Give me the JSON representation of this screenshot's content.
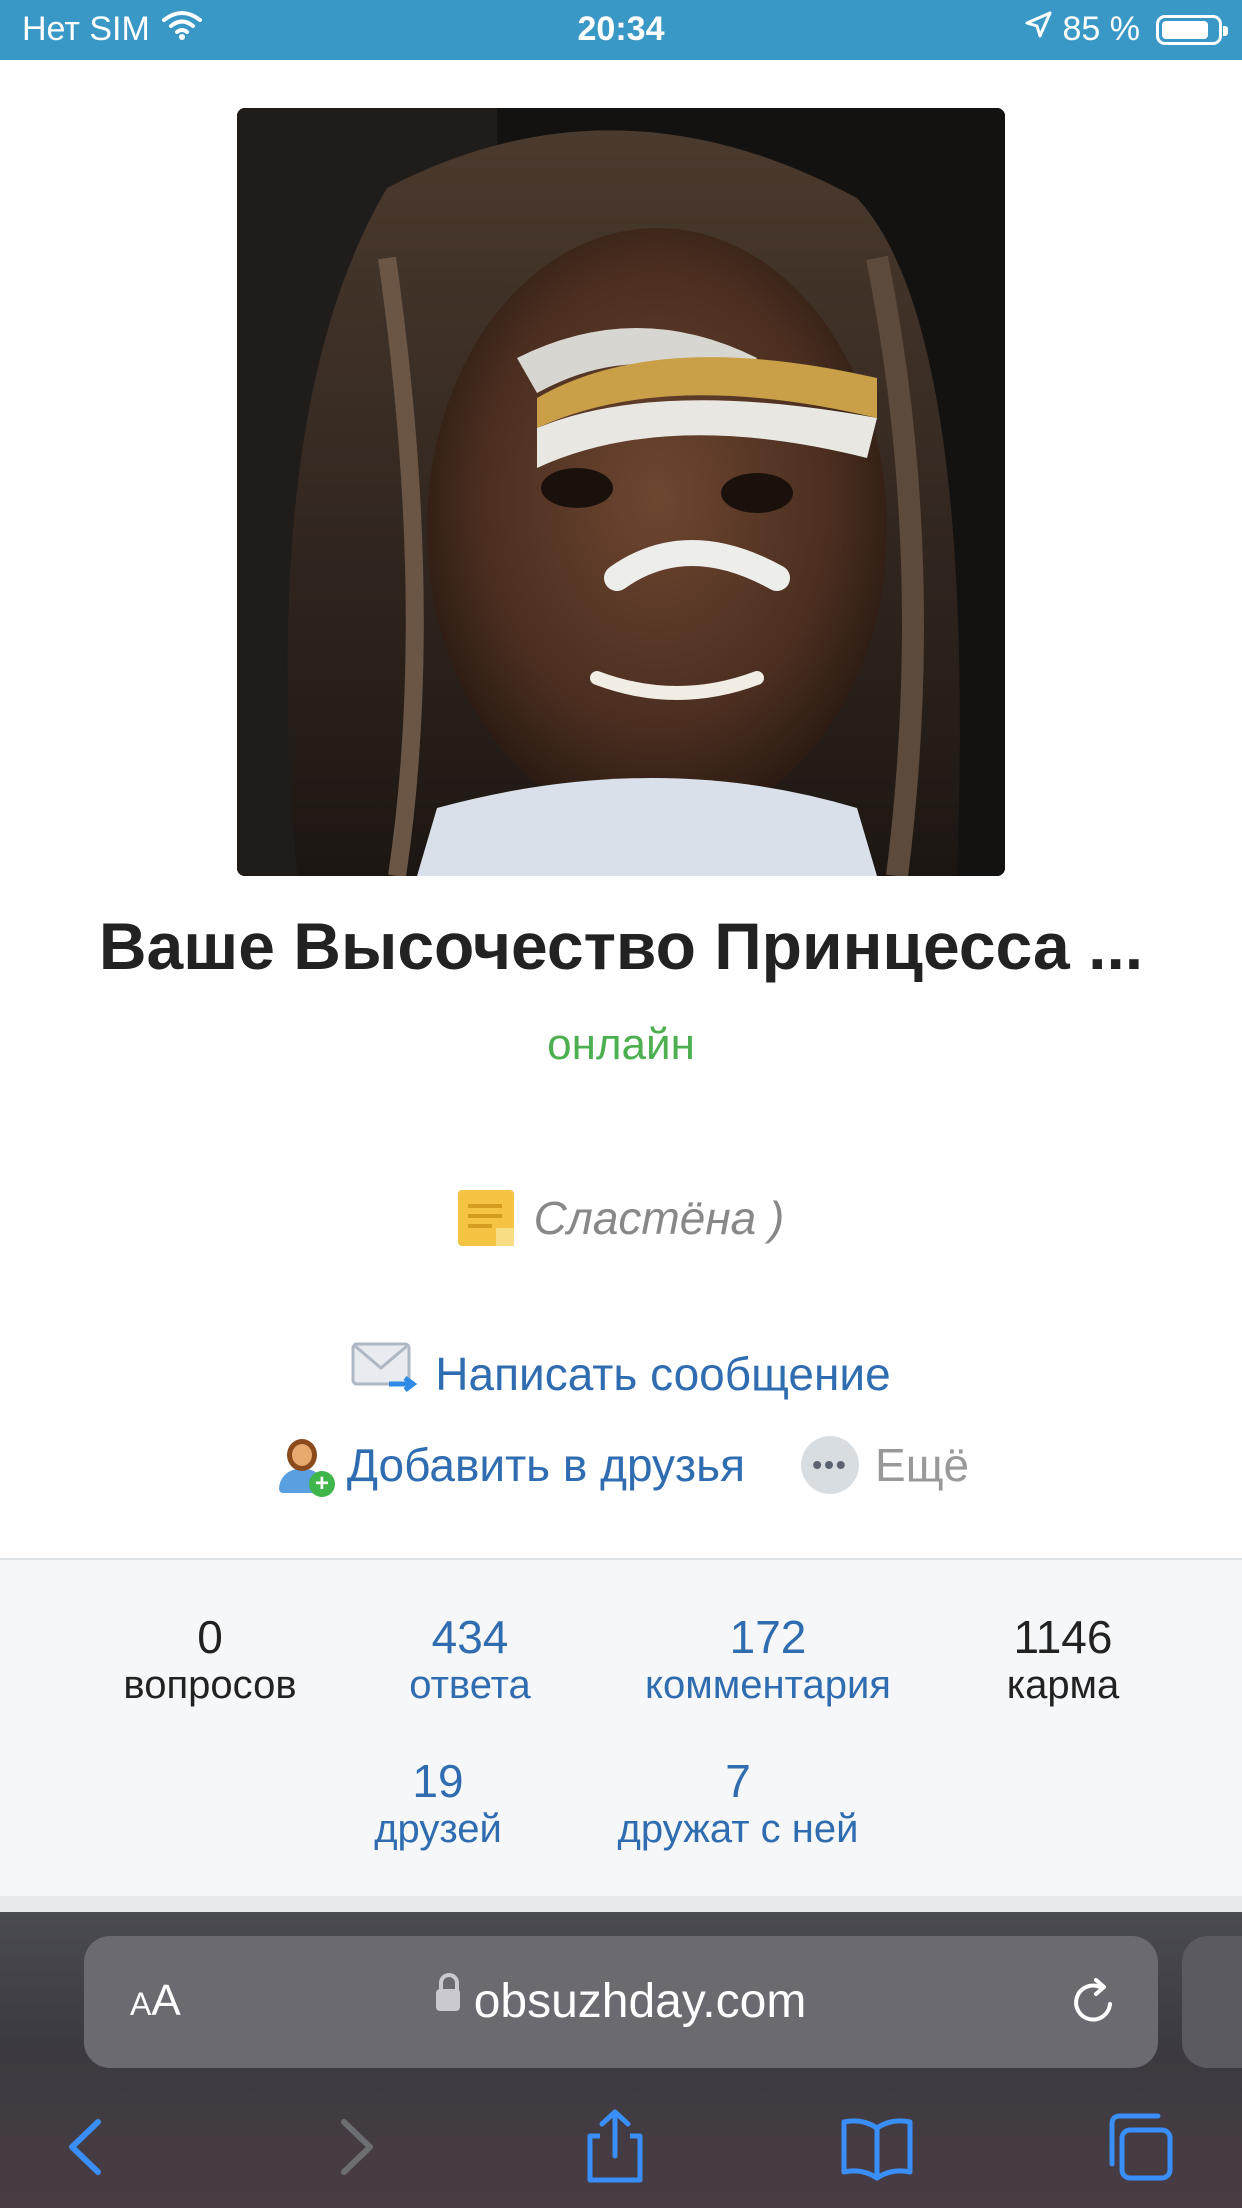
{
  "status_bar": {
    "carrier": "Нет SIM",
    "time": "20:34",
    "battery_text": "85 %",
    "battery_level": 0.85
  },
  "profile": {
    "name": "Ваше Высочество Принцесса ...",
    "online": "онлайн",
    "status_note": "Сластёна )"
  },
  "actions": {
    "send_message": "Написать сообщение",
    "add_friend": "Добавить в друзья",
    "more": "Ещё"
  },
  "stats": [
    {
      "value": "0",
      "label": "вопросов"
    },
    {
      "value": "434",
      "label": "ответа"
    },
    {
      "value": "172",
      "label": "комментария"
    },
    {
      "value": "1146",
      "label": "карма"
    },
    {
      "value": "19",
      "label": "друзей"
    },
    {
      "value": "7",
      "label": "дружат с ней"
    }
  ],
  "browser": {
    "text_size": "AA",
    "url": "obsuzhday.com",
    "icons": [
      "back-icon",
      "forward-icon",
      "share-icon",
      "bookmarks-icon",
      "tabs-icon",
      "reload-icon",
      "lock-icon"
    ]
  },
  "colors": {
    "status_bar": "#3a98c6",
    "link_blue": "#2f6db0",
    "online_green": "#4caf50"
  }
}
